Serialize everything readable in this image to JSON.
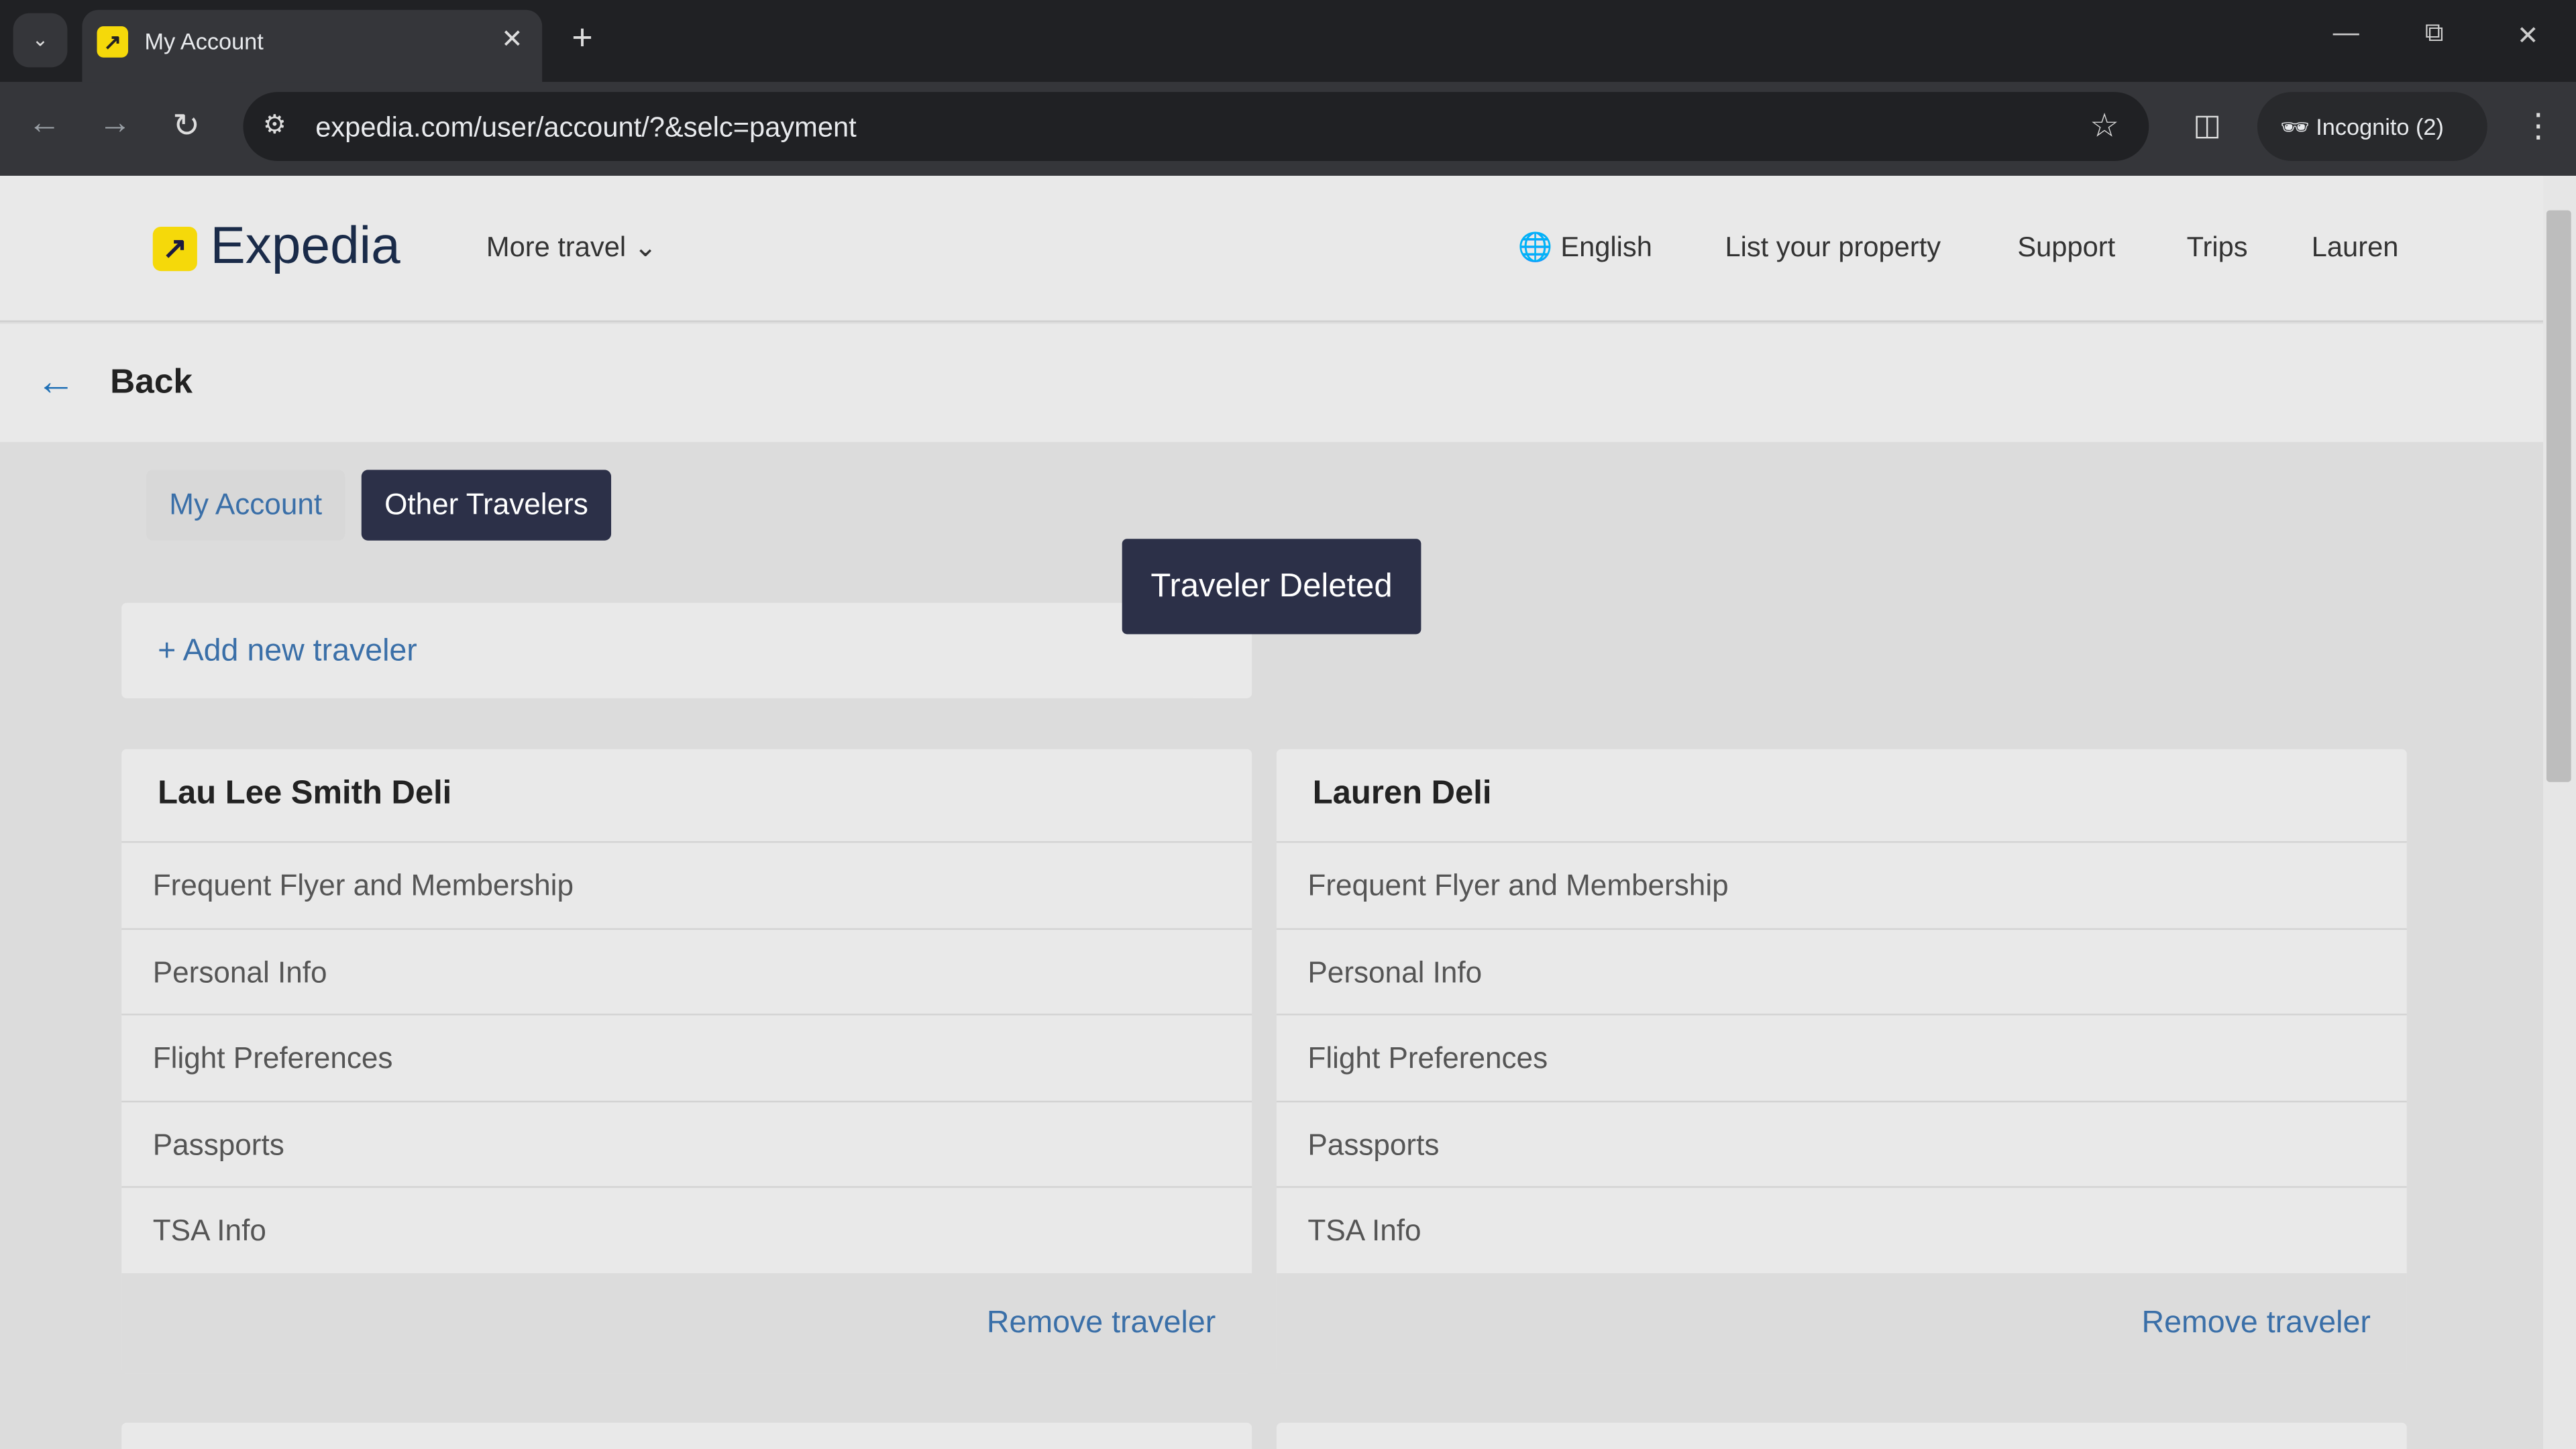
{
  "browser": {
    "tab_title": "My Account",
    "url": "expedia.com/user/account/?&selc=payment",
    "incognito_label": "Incognito (2)"
  },
  "header": {
    "logo": "Expedia",
    "more_travel": "More travel",
    "language": "English",
    "list_property": "List your property",
    "support": "Support",
    "trips": "Trips",
    "user": "Lauren"
  },
  "back_label": "Back",
  "tabs": [
    {
      "label": "My Account",
      "active": false
    },
    {
      "label": "Other Travelers",
      "active": true
    }
  ],
  "add_traveler": "+ Add new traveler",
  "toast": "Traveler Deleted",
  "travelers": [
    {
      "name": "Lau Lee Smith Deli",
      "sections": [
        "Frequent Flyer and Membership",
        "Personal Info",
        "Flight Preferences",
        "Passports",
        "TSA Info"
      ],
      "remove": "Remove traveler"
    },
    {
      "name": "Lauren Deli",
      "sections": [
        "Frequent Flyer and Membership",
        "Personal Info",
        "Flight Preferences",
        "Passports",
        "TSA Info"
      ],
      "remove": "Remove traveler"
    }
  ],
  "colors": {
    "brand_yellow": "#f5d90a",
    "dark_navy": "#2c3048",
    "link_blue": "#3a6fa8"
  }
}
